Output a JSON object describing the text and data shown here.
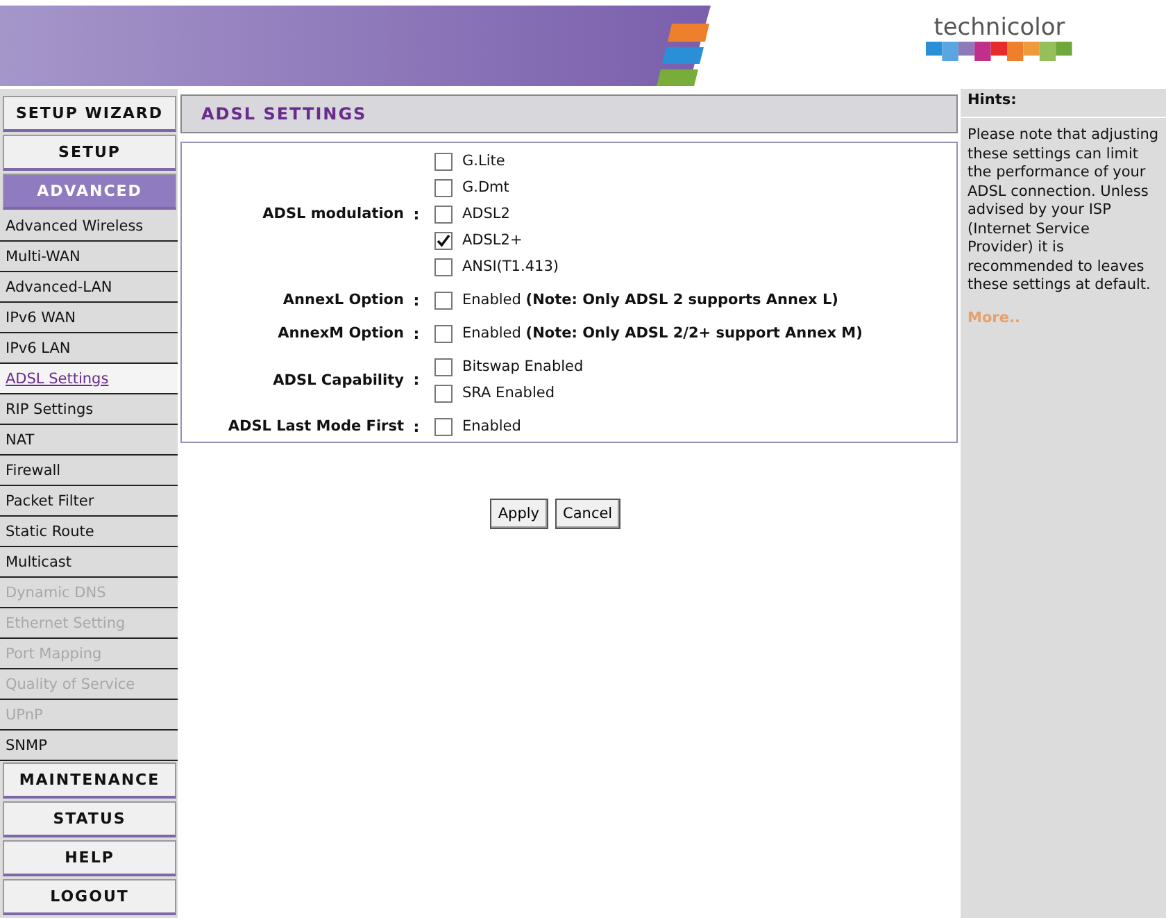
{
  "header": {
    "logo_text": "technicolor"
  },
  "sidebar": [
    {
      "kind": "section",
      "label": "SETUP WIZARD",
      "selected": false
    },
    {
      "kind": "section",
      "label": "SETUP",
      "selected": false
    },
    {
      "kind": "section",
      "label": "ADVANCED",
      "selected": true
    },
    {
      "kind": "link",
      "label": "Advanced Wireless",
      "selected": false,
      "disabled": false
    },
    {
      "kind": "link",
      "label": "Multi-WAN",
      "selected": false,
      "disabled": false
    },
    {
      "kind": "link",
      "label": "Advanced-LAN",
      "selected": false,
      "disabled": false
    },
    {
      "kind": "link",
      "label": "IPv6 WAN",
      "selected": false,
      "disabled": false
    },
    {
      "kind": "link",
      "label": "IPv6 LAN",
      "selected": false,
      "disabled": false
    },
    {
      "kind": "link",
      "label": "ADSL Settings",
      "selected": true,
      "disabled": false
    },
    {
      "kind": "link",
      "label": "RIP Settings",
      "selected": false,
      "disabled": false
    },
    {
      "kind": "link",
      "label": "NAT",
      "selected": false,
      "disabled": false
    },
    {
      "kind": "link",
      "label": "Firewall",
      "selected": false,
      "disabled": false
    },
    {
      "kind": "link",
      "label": "Packet Filter",
      "selected": false,
      "disabled": false
    },
    {
      "kind": "link",
      "label": "Static Route",
      "selected": false,
      "disabled": false
    },
    {
      "kind": "link",
      "label": "Multicast",
      "selected": false,
      "disabled": false
    },
    {
      "kind": "link",
      "label": "Dynamic DNS",
      "selected": false,
      "disabled": true
    },
    {
      "kind": "link",
      "label": "Ethernet Setting",
      "selected": false,
      "disabled": true
    },
    {
      "kind": "link",
      "label": "Port Mapping",
      "selected": false,
      "disabled": true
    },
    {
      "kind": "link",
      "label": "Quality of Service",
      "selected": false,
      "disabled": true
    },
    {
      "kind": "link",
      "label": "UPnP",
      "selected": false,
      "disabled": true
    },
    {
      "kind": "link",
      "label": "SNMP",
      "selected": false,
      "disabled": false
    },
    {
      "kind": "section",
      "label": "MAINTENANCE",
      "selected": false
    },
    {
      "kind": "section",
      "label": "STATUS",
      "selected": false
    },
    {
      "kind": "section",
      "label": "HELP",
      "selected": false
    },
    {
      "kind": "section",
      "label": "LOGOUT",
      "selected": false
    }
  ],
  "panel": {
    "title": "ADSL SETTINGS",
    "rows": [
      {
        "label": "ADSL modulation",
        "separator": ":",
        "options": [
          {
            "label": "G.Lite",
            "checked": false
          },
          {
            "label": "G.Dmt",
            "checked": false
          },
          {
            "label": "ADSL2",
            "checked": false
          },
          {
            "label": "ADSL2+",
            "checked": true
          },
          {
            "label": "ANSI(T1.413)",
            "checked": false
          }
        ]
      },
      {
        "label": "AnnexL Option",
        "separator": ":",
        "options": [
          {
            "label": "Enabled **(Note: Only ADSL 2 supports Annex L)**",
            "checked": false
          }
        ]
      },
      {
        "label": "AnnexM Option",
        "separator": ":",
        "options": [
          {
            "label": "Enabled **(Note: Only ADSL 2/2+ support Annex M)**",
            "checked": false
          }
        ]
      },
      {
        "label": "ADSL Capability",
        "separator": ":",
        "options": [
          {
            "label": "Bitswap Enabled",
            "checked": false
          },
          {
            "label": "SRA Enabled",
            "checked": false
          }
        ]
      },
      {
        "label": "ADSL Last Mode First",
        "separator": ":",
        "options": [
          {
            "label": "Enabled",
            "checked": false
          }
        ]
      }
    ],
    "buttons": [
      "Apply",
      "Cancel"
    ]
  },
  "hints": {
    "title": "Hints:",
    "text": "Please note that adjusting these settings can limit the performance of your ADSL connection. Unless advised by your ISP (Internet Service Provider) it is recommended to leaves these settings at default.",
    "more": "More.."
  }
}
